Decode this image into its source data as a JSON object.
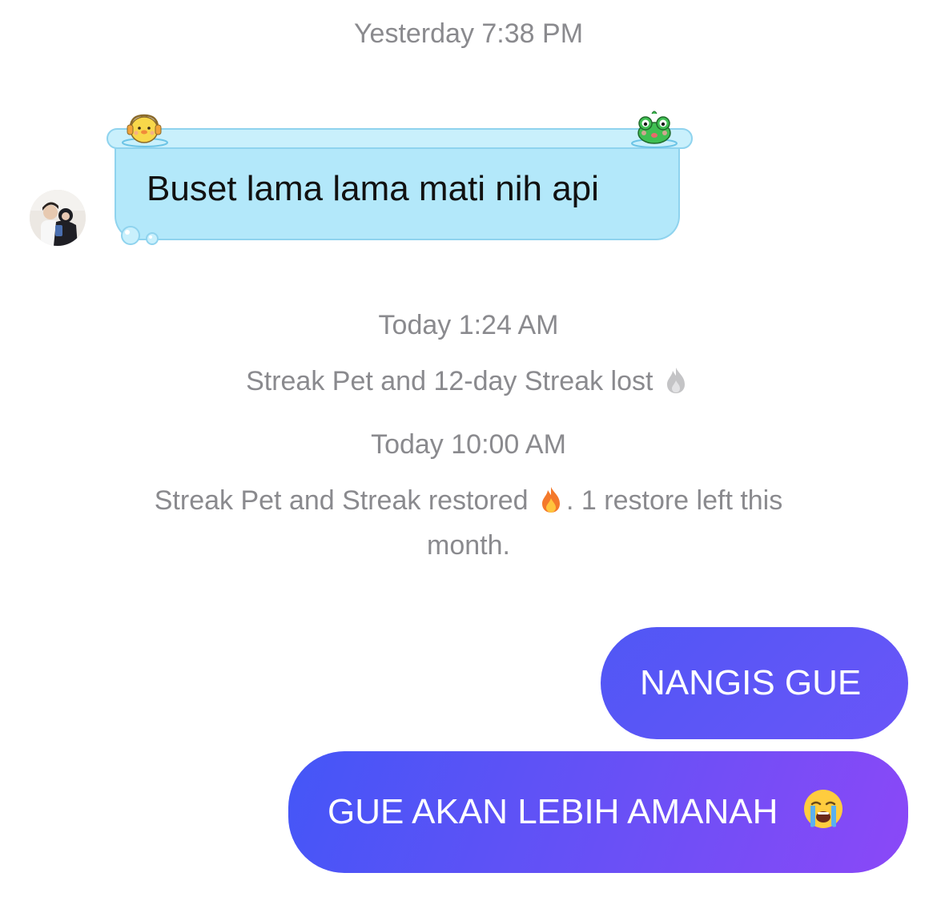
{
  "timestamps": {
    "first": "Yesterday 7:38 PM",
    "second": "Today 1:24 AM",
    "third": "Today 10:00 AM"
  },
  "system_messages": {
    "streak_lost": "Streak Pet and 12-day Streak lost",
    "streak_restored_a": "Streak Pet and Streak restored",
    "streak_restored_b": ". 1 restore left this month."
  },
  "messages": {
    "incoming": "Buset lama lama mati nih api",
    "outgoing_1": "NANGIS GUE",
    "outgoing_2": "GUE AKAN LEBIH AMANAH"
  },
  "icons": {
    "lost_fire": "grey-fire-icon",
    "restored_fire": "fire-icon",
    "crying": "loudly-crying-face-icon",
    "duck": "duck-sticker-icon",
    "frog": "frog-sticker-icon"
  },
  "colors": {
    "incoming_bubble": "#b3e8fa",
    "outgoing_start": "#4456f7",
    "outgoing_end": "#8b48f7",
    "meta_text": "#8a8a8e"
  }
}
